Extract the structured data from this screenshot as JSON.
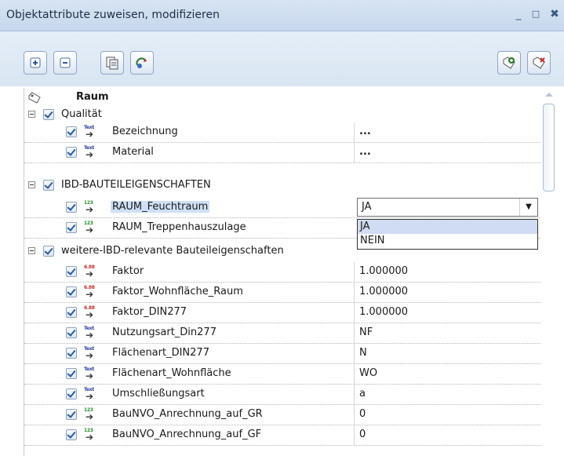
{
  "window": {
    "title": "Objektattribute zuweisen, modifizieren",
    "minimize_glyph": "_",
    "maximize_glyph": "□",
    "close_glyph": "✖"
  },
  "toolbar": {
    "buttons": [
      {
        "name": "expand-icon"
      },
      {
        "name": "collapse-icon"
      },
      {
        "name": "attribute-list-icon"
      },
      {
        "name": "attribute-refresh-icon"
      },
      {
        "name": "tag-add-icon"
      },
      {
        "name": "tag-delete-icon"
      }
    ]
  },
  "tree": {
    "root_label": "Raum",
    "groups": [
      {
        "label": "Qualität",
        "props": [
          {
            "label": "Bezeichnung",
            "type": "Text",
            "value": "",
            "ellipsis": "..."
          },
          {
            "label": "Material",
            "type": "Text",
            "value": "",
            "ellipsis": "..."
          }
        ]
      },
      {
        "label": "IBD-BAUTEILEIGENSCHAFTEN",
        "props": [
          {
            "label": "RAUM_Feuchtraum",
            "type": "123",
            "value": "JA"
          },
          {
            "label": "RAUM_Treppenhauszulage",
            "type": "123",
            "value": ""
          }
        ]
      },
      {
        "label": "weitere-IBD-relevante Bauteileigenschaften",
        "props": [
          {
            "label": "Faktor",
            "type": "6.88",
            "value": "1.000000"
          },
          {
            "label": "Faktor_Wohnfläche_Raum",
            "type": "6.88",
            "value": "1.000000"
          },
          {
            "label": "Faktor_DIN277",
            "type": "6.88",
            "value": "1.000000"
          },
          {
            "label": "Nutzungsart_Din277",
            "type": "Text",
            "value": "NF"
          },
          {
            "label": "Flächenart_DIN277",
            "type": "Text",
            "value": "N"
          },
          {
            "label": "Flächenart_Wohnfläche",
            "type": "Text",
            "value": "WO"
          },
          {
            "label": "Umschließungsart",
            "type": "Text",
            "value": "a"
          },
          {
            "label": "BauNVO_Anrechnung_auf_GR",
            "type": "123",
            "value": "0"
          },
          {
            "label": "BauNVO_Anrechnung_auf_GF",
            "type": "123",
            "value": "0"
          }
        ]
      }
    ]
  },
  "combo": {
    "value": "JA",
    "options": [
      "JA",
      "NEIN"
    ],
    "selected": "JA",
    "arrow": "▼"
  },
  "colors": {
    "title_bg": "#c7d8ed",
    "toolbar_bg": "#dfe9f5",
    "selection": "#cfdcf1",
    "text_icon": "#2a3f9a",
    "int_icon": "#2a8a2a",
    "dec_icon": "#c0312b"
  }
}
